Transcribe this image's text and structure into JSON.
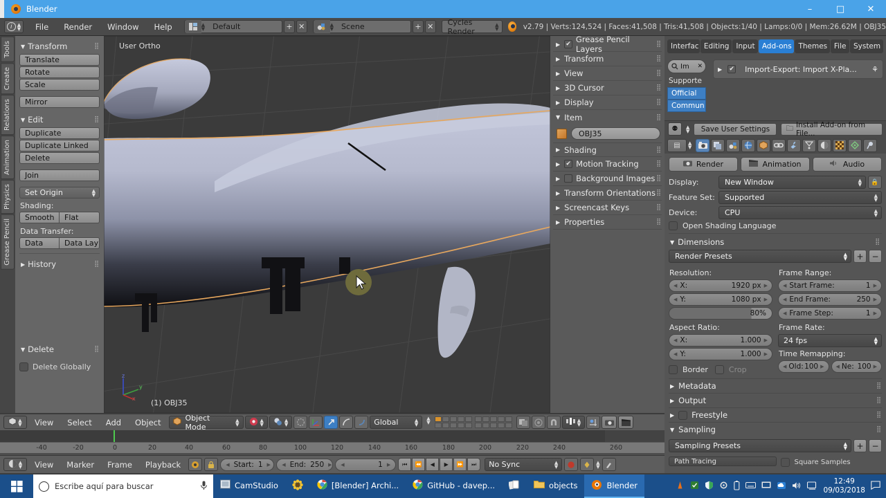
{
  "window": {
    "title": "Blender",
    "app_icon": "blender-logo-icon",
    "minimize": "–",
    "maximize": "□",
    "close": "✕"
  },
  "info_header": {
    "editor_type_icon": "info-editor-icon",
    "menus": [
      "File",
      "Render",
      "Window",
      "Help"
    ],
    "screen_layout": {
      "icon": "screen-layout-icon",
      "value": "Default",
      "add": "+",
      "remove": "✕"
    },
    "scene": {
      "icon": "scene-icon",
      "value": "Scene",
      "add": "+",
      "remove": "✕"
    },
    "engine": "Cycles Render",
    "stats": "v2.79 | Verts:124,524 | Faces:41,508 | Tris:41,508 | Objects:1/40 | Lamps:0/0 | Mem:26.62M | OBJ35"
  },
  "tool_tabs": [
    "Tools",
    "Create",
    "Relations",
    "Animation",
    "Physics",
    "Grease Pencil"
  ],
  "tool_panel": {
    "transform": {
      "title": "Transform",
      "buttons": [
        "Translate",
        "Rotate",
        "Scale"
      ],
      "mirror": "Mirror"
    },
    "edit": {
      "title": "Edit",
      "buttons": [
        "Duplicate",
        "Duplicate Linked",
        "Delete"
      ],
      "join": "Join",
      "set_origin": "Set Origin",
      "shading_label": "Shading:",
      "shading": [
        "Smooth",
        "Flat"
      ],
      "data_transfer_label": "Data Transfer:",
      "data_transfer": [
        "Data",
        "Data Lay"
      ]
    },
    "history": {
      "title": "History"
    }
  },
  "delete_panel": {
    "title": "Delete",
    "checkbox_label": "Delete Globally",
    "checked": false
  },
  "viewport": {
    "view_label": "User Ortho",
    "object_label": "(1) OBJ35",
    "axis": {
      "x": "x",
      "y": "y",
      "z": "z"
    },
    "cursor_color": "#6e6b3c",
    "outline_color": "#e8a85e"
  },
  "n_panel": {
    "items": [
      {
        "label": "Grease Pencil Layers",
        "open": false,
        "checkbox": true,
        "checked": true
      },
      {
        "label": "Transform",
        "open": false
      },
      {
        "label": "View",
        "open": false
      },
      {
        "label": "3D Cursor",
        "open": false
      },
      {
        "label": "Display",
        "open": false
      },
      {
        "label": "Item",
        "open": true
      }
    ],
    "item_field": {
      "icon": "object-cube-icon",
      "value": "OBJ35"
    },
    "items_after": [
      {
        "label": "Shading",
        "open": false
      },
      {
        "label": "Motion Tracking",
        "open": false,
        "checkbox": true,
        "checked": true
      },
      {
        "label": "Background Images",
        "open": false,
        "checkbox": true,
        "checked": false
      },
      {
        "label": "Transform Orientations",
        "open": false
      },
      {
        "label": "Screencast Keys",
        "open": false
      },
      {
        "label": "Properties",
        "open": false
      }
    ]
  },
  "user_prefs": {
    "tabs": [
      "Interfac",
      "Editing",
      "Input",
      "Add-ons",
      "Themes",
      "File",
      "System"
    ],
    "active_tab": "Add-ons",
    "search": {
      "icon": "search-icon",
      "value": "Im",
      "clear": "✕"
    },
    "supported_label": "Supporte",
    "filters": [
      "Official",
      "Commun"
    ],
    "addon": {
      "expand": "▶",
      "enabled": true,
      "label": "Import-Export: Import X-Pla...",
      "trailing_icon": "script-icon"
    },
    "footer": {
      "preset_icon": "user-preset-icon",
      "save": "Save User Settings",
      "install": "Install Add-on from File..."
    }
  },
  "properties": {
    "tab_icons": [
      "render-camera-icon",
      "render-layers-icon",
      "scene-icon",
      "world-icon",
      "object-cube-icon",
      "constraints-icon",
      "modifiers-wrench-icon",
      "particles-icon",
      "physics-icon",
      "texture-checker-icon",
      "data-mesh-icon",
      "material-icon"
    ],
    "active_tab": "render-camera-icon",
    "big_buttons": [
      {
        "label": "Render",
        "icon": "render-camera-icon"
      },
      {
        "label": "Animation",
        "icon": "clapboard-icon"
      },
      {
        "label": "Audio",
        "icon": "speaker-icon"
      }
    ],
    "fields": [
      {
        "label": "Display:",
        "value": "New Window",
        "lock_icon": "lock-icon"
      },
      {
        "label": "Feature Set:",
        "value": "Supported"
      },
      {
        "label": "Device:",
        "value": "CPU"
      }
    ],
    "osl_checkbox": {
      "label": "Open Shading Language",
      "checked": false
    },
    "dimensions": {
      "title": "Dimensions",
      "preset": "Render Presets",
      "resolution_label": "Resolution:",
      "resolution_x": {
        "label": "X:",
        "value": "1920 px"
      },
      "resolution_y": {
        "label": "Y:",
        "value": "1080 px"
      },
      "resolution_pct": "80%",
      "aspect_label": "Aspect Ratio:",
      "aspect_x": {
        "label": "X:",
        "value": "1.000"
      },
      "aspect_y": {
        "label": "Y:",
        "value": "1.000"
      },
      "border": {
        "label": "Border",
        "checked": false
      },
      "crop": {
        "label": "Crop",
        "checked": false
      },
      "frame_range_label": "Frame Range:",
      "start_frame": {
        "label": "Start Frame:",
        "value": "1"
      },
      "end_frame": {
        "label": "End Frame:",
        "value": "250"
      },
      "frame_step": {
        "label": "Frame Step:",
        "value": "1"
      },
      "frame_rate_label": "Frame Rate:",
      "frame_rate": "24 fps",
      "time_remap_label": "Time Remapping:",
      "time_old": {
        "label": "Old:",
        "value": "100"
      },
      "time_new": {
        "label": "Ne:",
        "value": "100"
      }
    },
    "collapsed": [
      {
        "label": "Metadata"
      },
      {
        "label": "Output"
      },
      {
        "label": "Freestyle",
        "checkbox": true,
        "checked": false
      }
    ],
    "sampling": {
      "title": "Sampling",
      "preset": "Sampling Presets",
      "path_tracing": "Path Tracing",
      "square_samples": "Square Samples"
    }
  },
  "viewport_header": {
    "editor_icon": "3d-view-icon",
    "menus": [
      "View",
      "Select",
      "Add",
      "Object"
    ],
    "mode": {
      "icon": "object-cube-icon",
      "value": "Object Mode"
    },
    "viewport_shading": "solid-shading-icon",
    "pivot": "pivot-icon",
    "snap_icons": [
      "manipulator-icon",
      "translate-manip-icon",
      "rotate-manip-icon",
      "scale-manip-icon"
    ],
    "orientation": "Global",
    "layers_icon": "layers-icon",
    "proportional_icon": "proportional-edit-icon",
    "snap_magnet_icon": "magnet-icon",
    "render_icons": [
      "render-camera-icon",
      "clapboard-icon"
    ]
  },
  "timeline": {
    "ticks": [
      "-40",
      "-20",
      "0",
      "20",
      "40",
      "60",
      "80",
      "100",
      "120",
      "140",
      "160",
      "180",
      "200",
      "220",
      "240",
      "260"
    ],
    "playhead_frame": "0",
    "editor_icon": "timeline-icon",
    "menus": [
      "View",
      "Marker",
      "Frame",
      "Playback"
    ],
    "start": {
      "label": "Start:",
      "value": "1"
    },
    "end": {
      "label": "End:",
      "value": "250"
    },
    "current": {
      "value": "1"
    },
    "transport": [
      "⏮",
      "⏪",
      "◀",
      "▶",
      "⏩",
      "⏭"
    ],
    "sync": "No Sync",
    "record_icon": "record-icon",
    "keying_icon": "keying-set-icon",
    "autokey_icon": "autokey-icon"
  },
  "taskbar": {
    "start_icon": "windows-start-icon",
    "search_placeholder": "Escribe aquí para buscar",
    "search_circle_icon": "cortana-circle-icon",
    "mic_icon": "microphone-icon",
    "items": [
      {
        "label": "CamStudio",
        "icon": "camstudio-icon",
        "active": false
      },
      {
        "label": "",
        "icon": "sunflower-icon",
        "active": false
      },
      {
        "label": "[Blender] Archi...",
        "icon": "chrome-icon",
        "active": false
      },
      {
        "label": "GitHub - davep...",
        "icon": "chrome-icon",
        "active": false
      },
      {
        "label": "",
        "icon": "cards-icon",
        "active": false
      },
      {
        "label": "objects",
        "icon": "folder-icon",
        "active": false
      },
      {
        "label": "Blender",
        "icon": "blender-logo-icon",
        "active": true
      }
    ],
    "tray_icons": [
      "vlc-icon",
      "shield-green-icon",
      "defender-icon",
      "gear-icon",
      "battery-icon",
      "keyboard-icon",
      "monitor-icon",
      "onedrive-icon",
      "volume-icon",
      "network-icon"
    ],
    "time": "12:49",
    "date": "09/03/2018",
    "notifications_icon": "notification-icon"
  }
}
